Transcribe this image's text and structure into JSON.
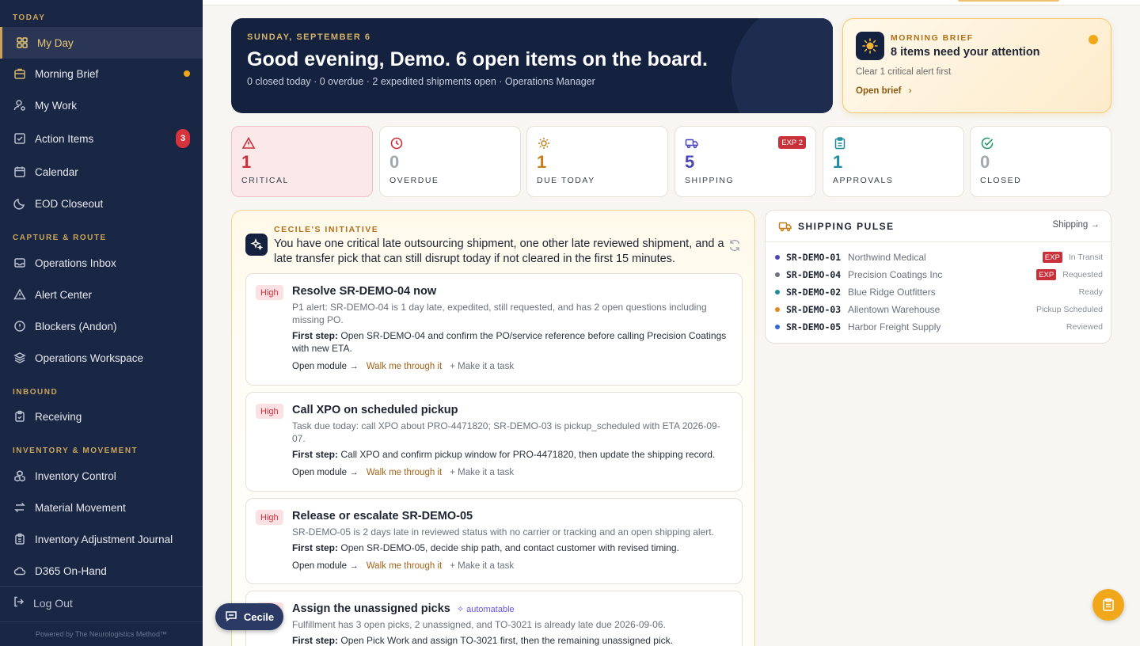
{
  "sidebar": {
    "sections": {
      "today": "TODAY",
      "capture": "CAPTURE & ROUTE",
      "inbound": "INBOUND",
      "inventory": "INVENTORY & MOVEMENT"
    },
    "items": [
      {
        "label": "My Day",
        "icon": "grid-icon"
      },
      {
        "label": "Morning Brief",
        "icon": "briefcase-icon"
      },
      {
        "label": "My Work",
        "icon": "user-gear-icon"
      },
      {
        "label": "Action Items",
        "icon": "checkbox-icon",
        "badge": "3"
      },
      {
        "label": "Calendar",
        "icon": "calendar-icon"
      },
      {
        "label": "EOD Closeout",
        "icon": "moon-icon"
      },
      {
        "label": "Operations Inbox",
        "icon": "inbox-icon"
      },
      {
        "label": "Alert Center",
        "icon": "warning-icon"
      },
      {
        "label": "Blockers (Andon)",
        "icon": "alert-circle-icon"
      },
      {
        "label": "Operations Workspace",
        "icon": "layers-icon"
      },
      {
        "label": "Receiving",
        "icon": "clipboard-icon"
      },
      {
        "label": "Inventory Control",
        "icon": "boxes-icon"
      },
      {
        "label": "Material Movement",
        "icon": "arrows-icon"
      },
      {
        "label": "Inventory Adjustment Journal",
        "icon": "clipboard-list-icon"
      },
      {
        "label": "D365 On-Hand",
        "icon": "cloud-icon"
      }
    ],
    "logout": "Log Out",
    "powered": "Powered by The Neurologistics Method™"
  },
  "greeting": {
    "date": "SUNDAY, SEPTEMBER 6",
    "title": "Good evening, Demo. 6 open items on the board.",
    "sub": "0 closed today · 0 overdue · 2 expedited shipments open · Operations Manager"
  },
  "brief": {
    "label": "MORNING BRIEF",
    "headline": "8 items need your attention",
    "hint": "Clear 1 critical alert first",
    "open": "Open brief"
  },
  "stats": [
    {
      "value": "1",
      "label": "CRITICAL",
      "color": "#c8313a",
      "icon": "warning-icon"
    },
    {
      "value": "0",
      "label": "OVERDUE",
      "color": "#a2a7b2",
      "icon": "clock-icon"
    },
    {
      "value": "1",
      "label": "DUE TODAY",
      "color": "#c47f1a",
      "icon": "sun-icon"
    },
    {
      "value": "5",
      "label": "SHIPPING",
      "color": "#4a46b8",
      "icon": "truck-icon",
      "badge": "EXP 2"
    },
    {
      "value": "1",
      "label": "APPROVALS",
      "color": "#1e8aa0",
      "icon": "clipboard-icon"
    },
    {
      "value": "0",
      "label": "CLOSED",
      "color": "#a2a7b2",
      "icon": "check-circle-icon"
    }
  ],
  "initiative": {
    "label": "CECILE'S INITIATIVE",
    "headline": "You have one critical late outsourcing shipment, one other late reviewed shipment, and a late transfer pick that can still disrupt today if not cleared in the first 15 minutes.",
    "tasks": [
      {
        "priority": "High",
        "title": "Resolve SR-DEMO-04 now",
        "desc": "P1 alert: SR-DEMO-04 is 1 day late, expedited, still requested, and has 2 open questions including missing PO.",
        "step_label": "First step:",
        "step": "Open SR-DEMO-04 and confirm the PO/service reference before calling Precision Coatings with new ETA."
      },
      {
        "priority": "High",
        "title": "Call XPO on scheduled pickup",
        "desc": "Task due today: call XPO about PRO-4471820; SR-DEMO-03 is pickup_scheduled with ETA 2026-09-07.",
        "step_label": "First step:",
        "step": "Call XPO and confirm pickup window for PRO-4471820, then update the shipping record."
      },
      {
        "priority": "High",
        "title": "Release or escalate SR-DEMO-05",
        "desc": "SR-DEMO-05 is 2 days late in reviewed status with no carrier or tracking and an open shipping alert.",
        "step_label": "First step:",
        "step": "Open SR-DEMO-05, decide ship path, and contact customer with revised timing."
      },
      {
        "priority": "High",
        "title": "Assign the unassigned picks",
        "tag": "automatable",
        "desc": "Fulfillment has 3 open picks, 2 unassigned, and TO-3021 is already late due 2026-09-06.",
        "step_label": "First step:",
        "step": "Open Pick Work and assign TO-3021 first, then the remaining unassigned pick."
      }
    ],
    "actions": {
      "open": "Open module",
      "walk": "Walk me through it",
      "task": "Make it a task"
    }
  },
  "pulse": {
    "title": "SHIPPING PULSE",
    "link": "Shipping",
    "rows": [
      {
        "code": "SR-DEMO-01",
        "name": "Northwind Medical",
        "exp": "EXP",
        "status": "In Transit",
        "dot": "#4a46b8"
      },
      {
        "code": "SR-DEMO-04",
        "name": "Precision Coatings Inc",
        "exp": "EXP",
        "status": "Requested",
        "dot": "#6b7180"
      },
      {
        "code": "SR-DEMO-02",
        "name": "Blue Ridge Outfitters",
        "exp": "",
        "status": "Ready",
        "dot": "#1e8aa0"
      },
      {
        "code": "SR-DEMO-03",
        "name": "Allentown Warehouse",
        "exp": "",
        "status": "Pickup Scheduled",
        "dot": "#e08a1a"
      },
      {
        "code": "SR-DEMO-05",
        "name": "Harbor Freight Supply",
        "exp": "",
        "status": "Reviewed",
        "dot": "#2f6bd8"
      }
    ]
  },
  "cecile": {
    "label": "Cecile"
  }
}
